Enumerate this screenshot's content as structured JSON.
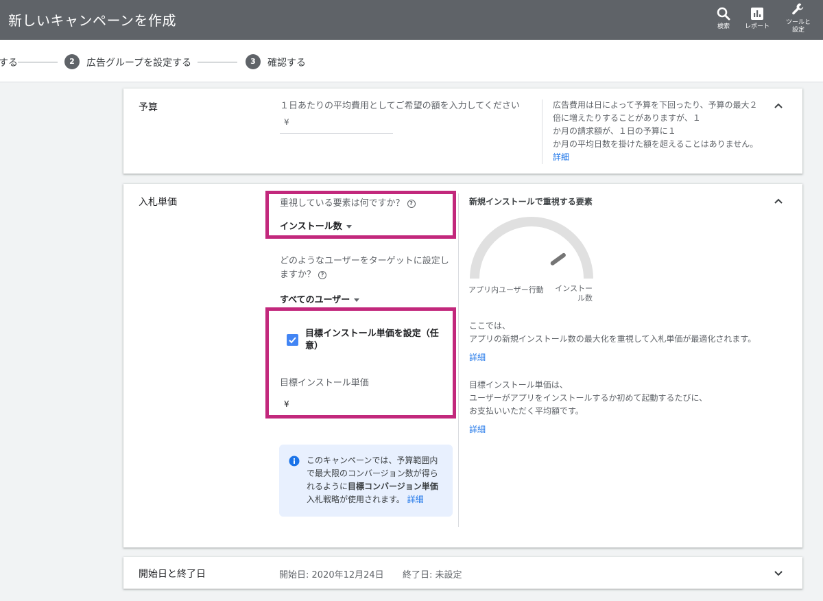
{
  "header": {
    "title": "新しいキャンペーンを作成",
    "search_label": "検索",
    "report_label": "レポート",
    "tools_label_line1": "ツールと",
    "tools_label_line2": "設定"
  },
  "stepper": {
    "step1_label": "する",
    "step2_number": "2",
    "step2_label": "広告グループを設定する",
    "step3_number": "3",
    "step3_label": "確認する"
  },
  "budget": {
    "title": "予算",
    "prompt": "１日あたりの平均費用としてご希望の額を入力してください",
    "currency": "¥",
    "help_lines": [
      "広告費用は日によって予算を下回ったり、予算の最大２",
      "倍に増えたりすることがありますが、１",
      "か月の請求額が、１日の予算に１",
      "か月の平均日数を掛けた額を超えることはありません。"
    ],
    "help_link": "詳細"
  },
  "bidding": {
    "title": "入札単価",
    "focus_question": "重視している要素は何ですか？",
    "focus_value": "インストール数",
    "target_question_line1": "どのようなユーザーをターゲットに設定し",
    "target_question_line2": "ますか？",
    "target_value": "すべてのユーザー",
    "checkbox_label_line1": "目標インストール単価を設定（任",
    "checkbox_label_line2": "意）",
    "target_cpi_label": "目標インストール単価",
    "currency": "¥",
    "info_line1": "このキャンペーンでは、予算範囲内",
    "info_line2": "で最大限のコンバージョン数が得ら",
    "info_line3_prefix": "れるように",
    "info_line3_bold": "目標コンバージョン単価",
    "info_line4": "入札戦略が使用されます。",
    "info_link": "詳細",
    "right_title": "新規インストールで重視する要素",
    "gauge_left_label": "アプリ内ユーザー行動",
    "gauge_right_label_line1": "インストー",
    "gauge_right_label_line2": "ル数",
    "gauge_value": 0.8,
    "desc1_line1": "ここでは、",
    "desc1_line2": "アプリの新規インストール数の最大化を重視して入札単価が最適化されます。",
    "desc1_link": "詳細",
    "desc2_line1": "目標インストール単価は、",
    "desc2_line2": "ユーザーがアプリをインストールするか初めて起動するたびに、",
    "desc2_line3": "お支払いいただく平均額です。",
    "desc2_link": "詳細"
  },
  "dates": {
    "title": "開始日と終了日",
    "start": "開始日: 2020年12月24日",
    "end": "終了日: 未設定"
  },
  "colors": {
    "header_bg": "#5f6368",
    "highlight": "#c2287c",
    "link": "#1a73e8",
    "checkbox": "#4285f4",
    "info_bg": "#e8f0fe"
  }
}
